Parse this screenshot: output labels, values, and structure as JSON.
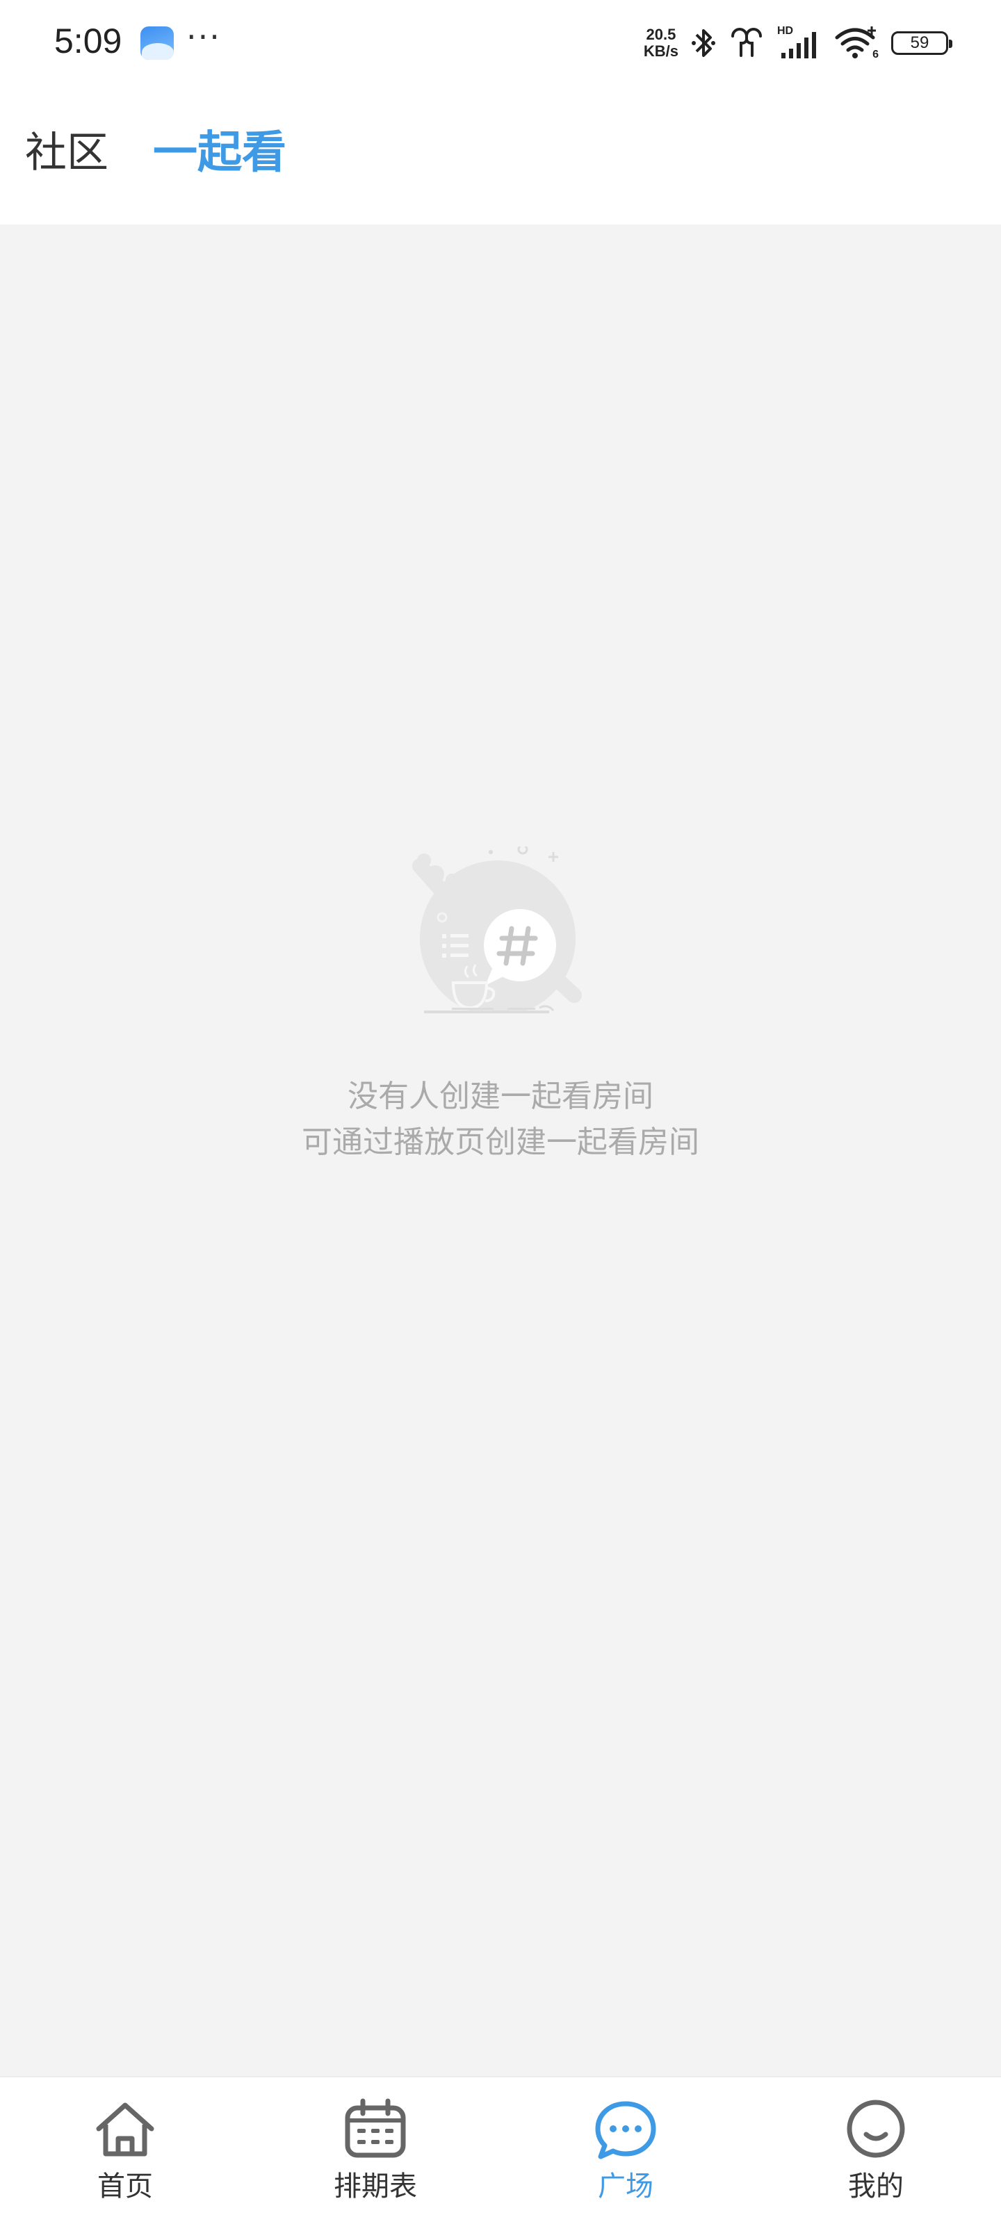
{
  "status_bar": {
    "time": "5:09",
    "more": "···",
    "net_speed_value": "20.5",
    "net_speed_unit": "KB/s",
    "signal_label": "HD",
    "wifi_label": "6",
    "battery": "59"
  },
  "header": {
    "tabs": [
      {
        "label": "社区",
        "active": false
      },
      {
        "label": "一起看",
        "active": true
      }
    ]
  },
  "empty_state": {
    "line1": "没有人创建一起看房间",
    "line2": "可通过播放页创建一起看房间",
    "icon": "hashtag-chat-illustration"
  },
  "bottom_nav": {
    "items": [
      {
        "label": "首页",
        "icon": "home-icon",
        "active": false
      },
      {
        "label": "排期表",
        "icon": "calendar-icon",
        "active": false
      },
      {
        "label": "广场",
        "icon": "chat-bubble-icon",
        "active": true
      },
      {
        "label": "我的",
        "icon": "smile-icon",
        "active": false
      }
    ]
  },
  "colors": {
    "accent": "#3f9ae6",
    "content_bg": "#f3f3f3",
    "muted_text": "#aaaaaa",
    "text": "#333333"
  }
}
